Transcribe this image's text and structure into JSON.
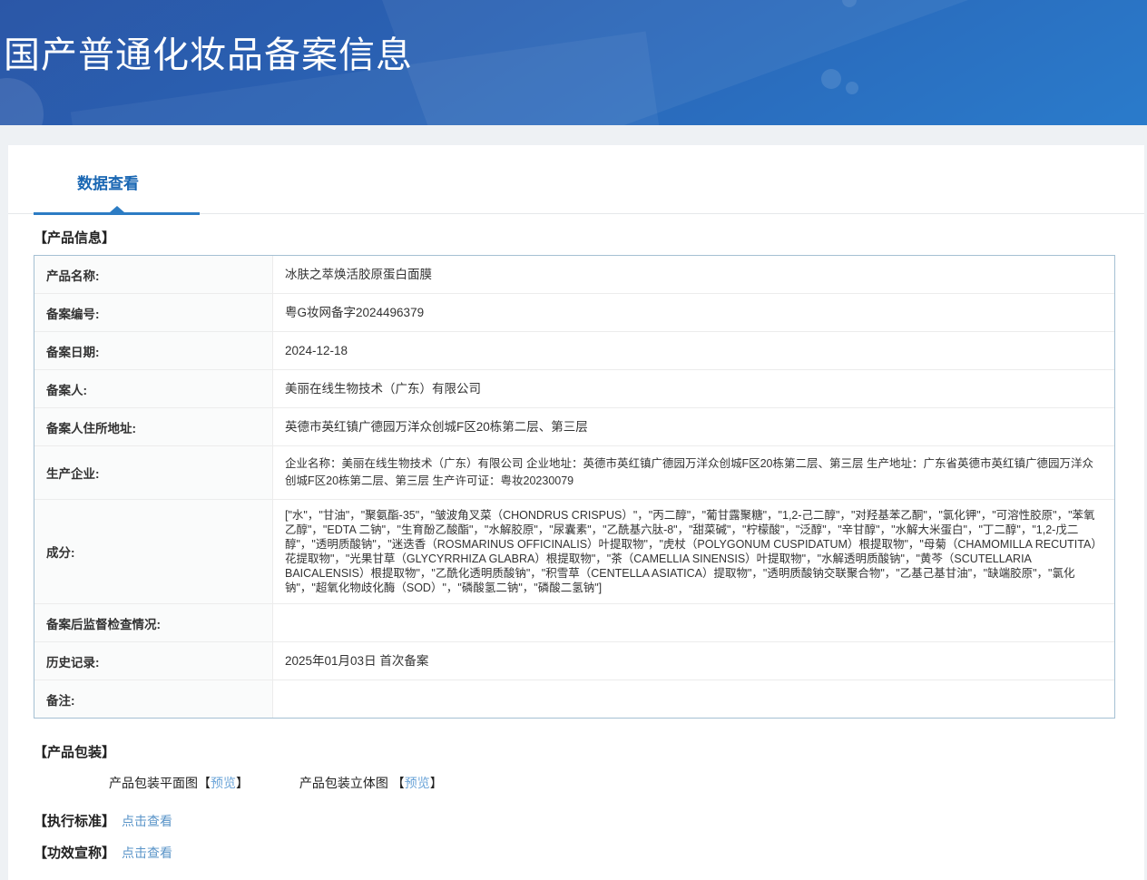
{
  "banner": {
    "title": "国产普通化妆品备案信息",
    "gradient_top": "#2b57a7",
    "gradient_bottom": "#2a7bcb"
  },
  "tabs": {
    "data_view_label": "数据查看",
    "active_color": "#1a67b3",
    "underline_color": "#2c7cc4"
  },
  "product_info": {
    "heading": "【产品信息】",
    "rows": [
      {
        "label": "产品名称:",
        "value": "冰肤之萃焕活胶原蛋白面膜"
      },
      {
        "label": "备案编号:",
        "value": "粤G妆网备字2024496379"
      },
      {
        "label": "备案日期:",
        "value": "2024-12-18"
      },
      {
        "label": "备案人:",
        "value": "美丽在线生物技术（广东）有限公司"
      },
      {
        "label": "备案人住所地址:",
        "value": "英德市英红镇广德园万洋众创城F区20栋第二层、第三层"
      },
      {
        "label": "生产企业:",
        "value": "企业名称：美丽在线生物技术（广东）有限公司 企业地址：英德市英红镇广德园万洋众创城F区20栋第二层、第三层 生产地址：广东省英德市英红镇广德园万洋众创城F区20栋第二层、第三层 生产许可证：粤妆20230079"
      },
      {
        "label": "成分:",
        "value": "[\"水\"，\"甘油\"，\"聚氨酯-35\"，\"皱波角叉菜（CHONDRUS CRISPUS）\"，\"丙二醇\"，\"葡甘露聚糖\"，\"1,2-己二醇\"，\"对羟基苯乙酮\"，\"氯化钾\"，\"可溶性胶原\"，\"苯氧乙醇\"，\"EDTA 二钠\"，\"生育酚乙酸酯\"，\"水解胶原\"，\"尿囊素\"，\"乙酰基六肽-8\"，\"甜菜碱\"，\"柠檬酸\"，\"泛醇\"，\"辛甘醇\"，\"水解大米蛋白\"，\"丁二醇\"，\"1,2-戊二醇\"，\"透明质酸钠\"，\"迷迭香（ROSMARINUS OFFICINALIS）叶提取物\"，\"虎杖（POLYGONUM CUSPIDATUM）根提取物\"，\"母菊（CHAMOMILLA RECUTITA）花提取物\"，\"光果甘草（GLYCYRRHIZA GLABRA）根提取物\"，\"茶（CAMELLIA SINENSIS）叶提取物\"，\"水解透明质酸钠\"，\"黄芩（SCUTELLARIA BAICALENSIS）根提取物\"，\"乙酰化透明质酸钠\"，\"积雪草（CENTELLA ASIATICA）提取物\"，\"透明质酸钠交联聚合物\"，\"乙基己基甘油\"，\"缺端胶原\"，\"氯化钠\"，\"超氧化物歧化酶（SOD）\"，\"磷酸氢二钠\"，\"磷酸二氢钠\"]"
      },
      {
        "label": "备案后监督检查情况:",
        "value": ""
      },
      {
        "label": "历史记录:",
        "value": "2025年01月03日 首次备案"
      },
      {
        "label": "备注:",
        "value": ""
      }
    ]
  },
  "packaging": {
    "heading": "【产品包装】",
    "bracket_open": "【",
    "bracket_close": "】",
    "items": [
      {
        "label": "产品包装平面图",
        "link": "预览"
      },
      {
        "label": "产品包装立体图 ",
        "link": "预览"
      }
    ]
  },
  "standard": {
    "heading": "【执行标准】",
    "link": "点击查看"
  },
  "efficacy": {
    "heading": "【功效宣称】",
    "link": "点击查看"
  },
  "colors": {
    "link_blue": "#5a94c8",
    "preview_blue": "#6ba4d8",
    "table_border": "#a5c0d3",
    "page_background": "#eef1f4"
  }
}
